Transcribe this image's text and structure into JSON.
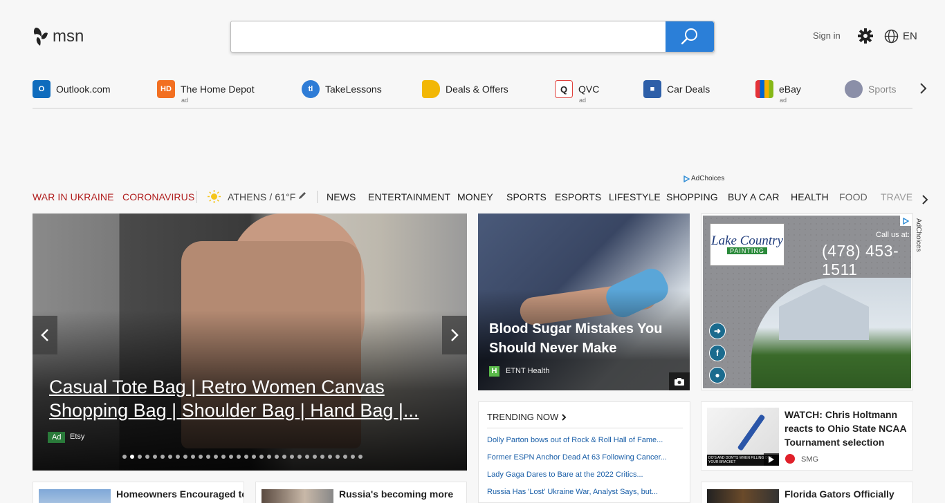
{
  "header": {
    "logo_text": "msn",
    "search_placeholder": "",
    "sign_in": "Sign in",
    "language": "EN"
  },
  "quick_links": [
    {
      "label": "Outlook.com",
      "ad": "",
      "icon": "outlook-icon",
      "color": "#0f6cbd"
    },
    {
      "label": "The Home Depot",
      "ad": "ad",
      "icon": "home-depot-icon",
      "color": "#f26f21"
    },
    {
      "label": "TakeLessons",
      "ad": "",
      "icon": "takelessons-icon",
      "color": "#2e7cd6"
    },
    {
      "label": "Deals & Offers",
      "ad": "",
      "icon": "tag-icon",
      "color": "#f2b705"
    },
    {
      "label": "QVC",
      "ad": "ad",
      "icon": "qvc-icon",
      "color": "#e0413c"
    },
    {
      "label": "Car Deals",
      "ad": "",
      "icon": "car-icon",
      "color": "#2e5fa8"
    },
    {
      "label": "eBay",
      "ad": "ad",
      "icon": "ebay-icon",
      "color": "#111111"
    },
    {
      "label": "Sports",
      "ad": "",
      "icon": "sports-icon",
      "color": "#8b8fa8"
    }
  ],
  "ad_choices": "AdChoices",
  "nav": {
    "war": "WAR IN UKRAINE",
    "corona": "CORONAVIRUS",
    "weather": "ATHENS / 61°F",
    "items": [
      "NEWS",
      "ENTERTAINMENT",
      "MONEY",
      "SPORTS",
      "ESPORTS",
      "LIFESTYLE",
      "SHOPPING",
      "BUY A CAR",
      "HEALTH",
      "FOOD",
      "TRAVEL"
    ]
  },
  "hero": {
    "title": "Casual Tote Bag | Retro Women Canvas Shopping Bag | Shoulder Bag | Hand Bag |...",
    "ad_label": "Ad",
    "source": "Etsy",
    "dot_count": 32,
    "active_dot": 2
  },
  "card2": {
    "title": "Blood Sugar Mistakes You Should Never Make",
    "source": "ETNT Health",
    "source_icon": "H"
  },
  "ad_right": {
    "logo_line1": "Lake Country",
    "logo_line2": "PAINTING",
    "call_us": "Call us at:",
    "phone": "(478) 453-1511",
    "side_label": "AdChoices"
  },
  "trending": {
    "heading": "TRENDING NOW",
    "items": [
      "Dolly Parton bows out of Rock & Roll Hall of Fame...",
      "Former ESPN Anchor Dead At 63 Following Cancer...",
      "Lady Gaga Dares to Bare at the 2022 Critics...",
      "Russia Has 'Lost' Ukraine War, Analyst Says, but..."
    ]
  },
  "rcard": {
    "title": "WATCH: Chris Holtmann reacts to Ohio State NCAA Tournament selection",
    "source": "SMG",
    "thumb_caption": "DO'S AND DON'TS WHEN FILLING OUT YOUR BRACKET"
  },
  "bottom": [
    {
      "title": "Homeowners Encouraged to"
    },
    {
      "title": "Russia's becoming more"
    },
    {
      "title": "Florida Gators Officially"
    }
  ]
}
